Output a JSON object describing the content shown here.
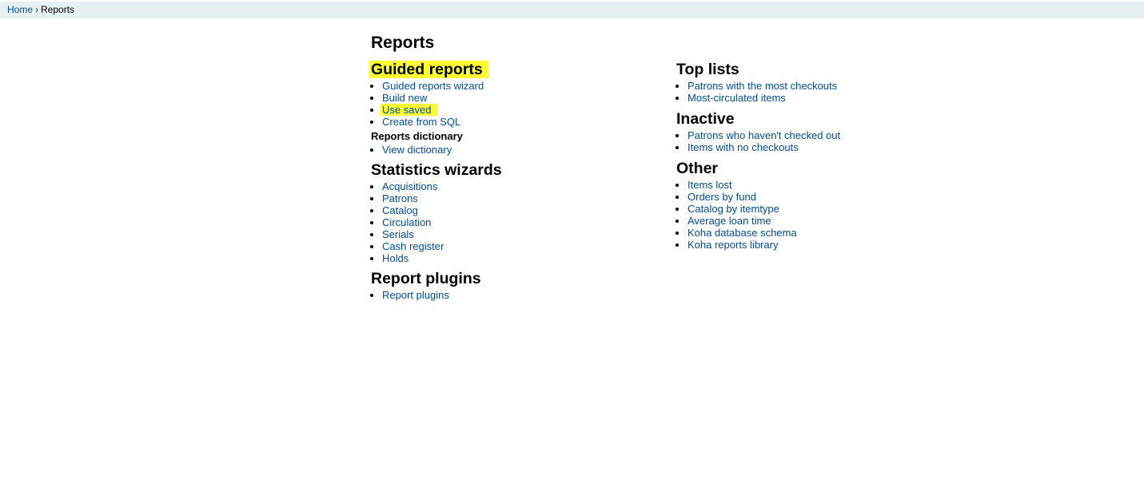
{
  "breadcrumb": {
    "home": "Home",
    "separator": "›",
    "current": "Reports"
  },
  "page_title": "Reports",
  "left": {
    "guided": {
      "title": "Guided reports",
      "items": [
        "Guided reports wizard",
        "Build new",
        "Use saved",
        "Create from SQL"
      ]
    },
    "dictionary": {
      "title": "Reports dictionary",
      "items": [
        "View dictionary"
      ]
    },
    "statistics": {
      "title": "Statistics wizards",
      "items": [
        "Acquisitions",
        "Patrons",
        "Catalog",
        "Circulation",
        "Serials",
        "Cash register",
        "Holds"
      ]
    },
    "plugins": {
      "title": "Report plugins",
      "items": [
        "Report plugins"
      ]
    }
  },
  "right": {
    "top_lists": {
      "title": "Top lists",
      "items": [
        "Patrons with the most checkouts",
        "Most-circulated items"
      ]
    },
    "inactive": {
      "title": "Inactive",
      "items": [
        "Patrons who haven't checked out",
        "Items with no checkouts"
      ]
    },
    "other": {
      "title": "Other",
      "items": [
        "Items lost",
        "Orders by fund",
        "Catalog by itemtype",
        "Average loan time",
        "Koha database schema",
        "Koha reports library"
      ]
    }
  },
  "colors": {
    "link": "#004d99",
    "highlight": "#ffff33",
    "breadcrumb_bg": "#e6f0f2"
  }
}
